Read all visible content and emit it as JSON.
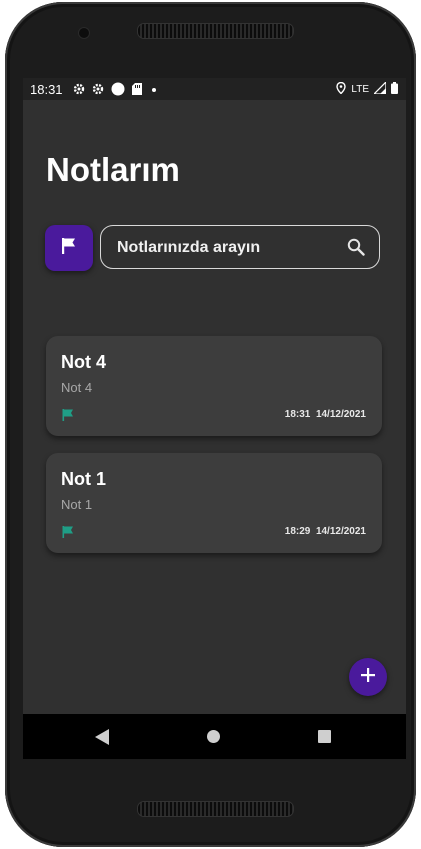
{
  "status_bar": {
    "time": "18:31",
    "network": "LTE",
    "icons_left": [
      "gear-icon",
      "gear-icon",
      "circle-icon",
      "sd-card-icon",
      "dot-icon"
    ],
    "icons_right": [
      "location-icon",
      "signal-icon",
      "battery-icon"
    ]
  },
  "header": {
    "title": "Notlarım"
  },
  "search": {
    "placeholder": "Notlarınızda arayın"
  },
  "notes": [
    {
      "title": "Not 4",
      "body": "Not 4",
      "time": "18:31",
      "date": "14/12/2021"
    },
    {
      "title": "Not 1",
      "body": "Not 1",
      "time": "18:29",
      "date": "14/12/2021"
    }
  ],
  "colors": {
    "accent": "#4a1a9c",
    "flag": "#1f9e86",
    "background": "#303030",
    "card": "#3d3d3d"
  }
}
